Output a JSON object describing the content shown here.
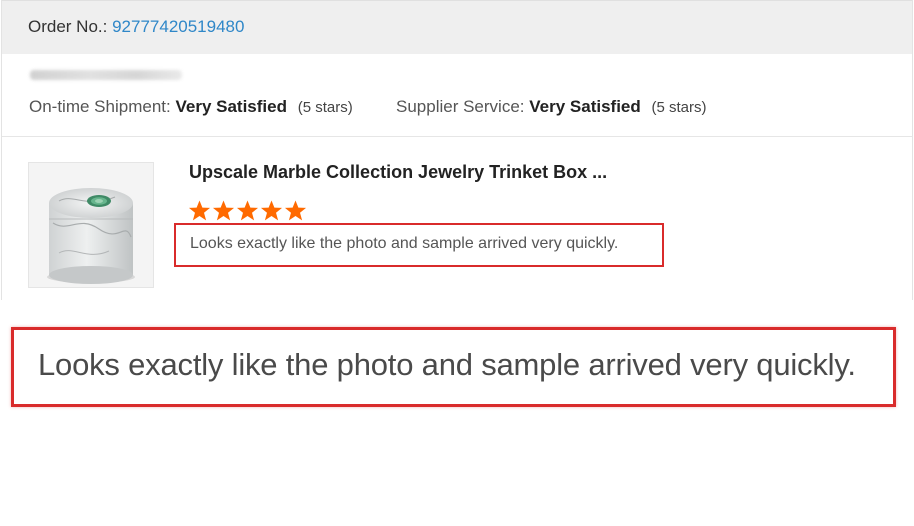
{
  "order": {
    "label": "Order No.:",
    "number": "92777420519480"
  },
  "ratings": [
    {
      "label": "On-time Shipment:",
      "value": "Very Satisfied",
      "stars_note": "(5 stars)"
    },
    {
      "label": "Supplier Service:",
      "value": "Very Satisfied",
      "stars_note": "(5 stars)"
    }
  ],
  "product": {
    "title": "Upscale Marble Collection Jewelry Trinket Box ...",
    "star_rating": 5,
    "star_max": 5,
    "star_color": "#ff6a00",
    "review": "Looks exactly like the photo and sample arrived very quickly."
  },
  "zoom": {
    "text": "Looks exactly like the photo and sample arrived very quickly."
  },
  "colors": {
    "highlight_border": "#d92b2b",
    "order_number": "#2f87c8"
  }
}
